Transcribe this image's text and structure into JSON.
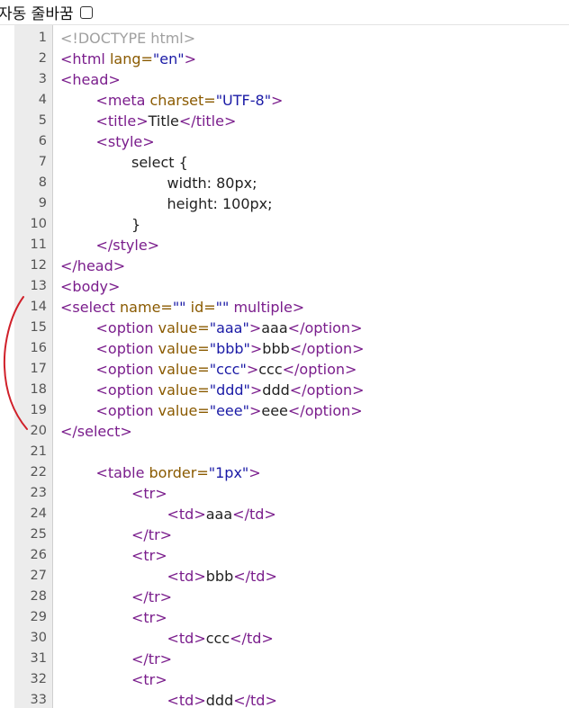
{
  "toolbar": {
    "wrap_label": "자동 줄바꿈",
    "wrap_checked": false
  },
  "lines": [
    {
      "n": "1",
      "indent": 0,
      "tokens": [
        {
          "t": "doc",
          "v": "<!DOCTYPE html>"
        }
      ]
    },
    {
      "n": "2",
      "indent": 0,
      "tokens": [
        {
          "t": "tag",
          "v": "<html "
        },
        {
          "t": "attr",
          "v": "lang="
        },
        {
          "t": "val",
          "v": "\"en\""
        },
        {
          "t": "tag",
          "v": ">"
        }
      ]
    },
    {
      "n": "3",
      "indent": 0,
      "tokens": [
        {
          "t": "tag",
          "v": "<head>"
        }
      ]
    },
    {
      "n": "4",
      "indent": 1,
      "tokens": [
        {
          "t": "tag",
          "v": "<meta "
        },
        {
          "t": "attr",
          "v": "charset="
        },
        {
          "t": "val",
          "v": "\"UTF-8\""
        },
        {
          "t": "tag",
          "v": ">"
        }
      ]
    },
    {
      "n": "5",
      "indent": 1,
      "tokens": [
        {
          "t": "tag",
          "v": "<title>"
        },
        {
          "t": "text",
          "v": "Title"
        },
        {
          "t": "tag",
          "v": "</title>"
        }
      ]
    },
    {
      "n": "6",
      "indent": 1,
      "tokens": [
        {
          "t": "tag",
          "v": "<style>"
        }
      ]
    },
    {
      "n": "7",
      "indent": 2,
      "tokens": [
        {
          "t": "css",
          "v": "select {"
        }
      ]
    },
    {
      "n": "8",
      "indent": 3,
      "tokens": [
        {
          "t": "css",
          "v": "width: 80px;"
        }
      ]
    },
    {
      "n": "9",
      "indent": 3,
      "tokens": [
        {
          "t": "css",
          "v": "height: 100px;"
        }
      ]
    },
    {
      "n": "10",
      "indent": 2,
      "tokens": [
        {
          "t": "css",
          "v": "}"
        }
      ]
    },
    {
      "n": "11",
      "indent": 1,
      "tokens": [
        {
          "t": "tag",
          "v": "</style>"
        }
      ]
    },
    {
      "n": "12",
      "indent": 0,
      "tokens": [
        {
          "t": "tag",
          "v": "</head>"
        }
      ]
    },
    {
      "n": "13",
      "indent": 0,
      "tokens": [
        {
          "t": "tag",
          "v": "<body>"
        }
      ]
    },
    {
      "n": "14",
      "indent": 0,
      "tokens": [
        {
          "t": "tag",
          "v": "<select "
        },
        {
          "t": "attr",
          "v": "name="
        },
        {
          "t": "val",
          "v": "\"\""
        },
        {
          "t": "tag",
          "v": " "
        },
        {
          "t": "attr",
          "v": "id="
        },
        {
          "t": "val",
          "v": "\"\""
        },
        {
          "t": "tag",
          "v": " multiple>"
        }
      ]
    },
    {
      "n": "15",
      "indent": 1,
      "tokens": [
        {
          "t": "tag",
          "v": "<option "
        },
        {
          "t": "attr",
          "v": "value="
        },
        {
          "t": "val",
          "v": "\"aaa\""
        },
        {
          "t": "tag",
          "v": ">"
        },
        {
          "t": "text",
          "v": "aaa"
        },
        {
          "t": "tag",
          "v": "</option>"
        }
      ]
    },
    {
      "n": "16",
      "indent": 1,
      "tokens": [
        {
          "t": "tag",
          "v": "<option "
        },
        {
          "t": "attr",
          "v": "value="
        },
        {
          "t": "val",
          "v": "\"bbb\""
        },
        {
          "t": "tag",
          "v": ">"
        },
        {
          "t": "text",
          "v": "bbb"
        },
        {
          "t": "tag",
          "v": "</option>"
        }
      ]
    },
    {
      "n": "17",
      "indent": 1,
      "tokens": [
        {
          "t": "tag",
          "v": "<option "
        },
        {
          "t": "attr",
          "v": "value="
        },
        {
          "t": "val",
          "v": "\"ccc\""
        },
        {
          "t": "tag",
          "v": ">"
        },
        {
          "t": "text",
          "v": "ccc"
        },
        {
          "t": "tag",
          "v": "</option>"
        }
      ]
    },
    {
      "n": "18",
      "indent": 1,
      "tokens": [
        {
          "t": "tag",
          "v": "<option "
        },
        {
          "t": "attr",
          "v": "value="
        },
        {
          "t": "val",
          "v": "\"ddd\""
        },
        {
          "t": "tag",
          "v": ">"
        },
        {
          "t": "text",
          "v": "ddd"
        },
        {
          "t": "tag",
          "v": "</option>"
        }
      ]
    },
    {
      "n": "19",
      "indent": 1,
      "tokens": [
        {
          "t": "tag",
          "v": "<option "
        },
        {
          "t": "attr",
          "v": "value="
        },
        {
          "t": "val",
          "v": "\"eee\""
        },
        {
          "t": "tag",
          "v": ">"
        },
        {
          "t": "text",
          "v": "eee"
        },
        {
          "t": "tag",
          "v": "</option>"
        }
      ]
    },
    {
      "n": "20",
      "indent": 0,
      "tokens": [
        {
          "t": "tag",
          "v": "</select>"
        }
      ]
    },
    {
      "n": "21",
      "indent": 0,
      "tokens": []
    },
    {
      "n": "22",
      "indent": 1,
      "tokens": [
        {
          "t": "tag",
          "v": "<table "
        },
        {
          "t": "attr",
          "v": "border="
        },
        {
          "t": "val",
          "v": "\"1px\""
        },
        {
          "t": "tag",
          "v": ">"
        }
      ]
    },
    {
      "n": "23",
      "indent": 2,
      "tokens": [
        {
          "t": "tag",
          "v": "<tr>"
        }
      ]
    },
    {
      "n": "24",
      "indent": 3,
      "tokens": [
        {
          "t": "tag",
          "v": "<td>"
        },
        {
          "t": "text",
          "v": "aaa"
        },
        {
          "t": "tag",
          "v": "</td>"
        }
      ]
    },
    {
      "n": "25",
      "indent": 2,
      "tokens": [
        {
          "t": "tag",
          "v": "</tr>"
        }
      ]
    },
    {
      "n": "26",
      "indent": 2,
      "tokens": [
        {
          "t": "tag",
          "v": "<tr>"
        }
      ]
    },
    {
      "n": "27",
      "indent": 3,
      "tokens": [
        {
          "t": "tag",
          "v": "<td>"
        },
        {
          "t": "text",
          "v": "bbb"
        },
        {
          "t": "tag",
          "v": "</td>"
        }
      ]
    },
    {
      "n": "28",
      "indent": 2,
      "tokens": [
        {
          "t": "tag",
          "v": "</tr>"
        }
      ]
    },
    {
      "n": "29",
      "indent": 2,
      "tokens": [
        {
          "t": "tag",
          "v": "<tr>"
        }
      ]
    },
    {
      "n": "30",
      "indent": 3,
      "tokens": [
        {
          "t": "tag",
          "v": "<td>"
        },
        {
          "t": "text",
          "v": "ccc"
        },
        {
          "t": "tag",
          "v": "</td>"
        }
      ]
    },
    {
      "n": "31",
      "indent": 2,
      "tokens": [
        {
          "t": "tag",
          "v": "</tr>"
        }
      ]
    },
    {
      "n": "32",
      "indent": 2,
      "tokens": [
        {
          "t": "tag",
          "v": "<tr>"
        }
      ]
    },
    {
      "n": "33",
      "indent": 3,
      "tokens": [
        {
          "t": "tag",
          "v": "<td>"
        },
        {
          "t": "text",
          "v": "ddd"
        },
        {
          "t": "tag",
          "v": "</td>"
        }
      ]
    }
  ],
  "colors": {
    "tag": "#7a1d8c",
    "attr": "#8a5a00",
    "val": "#1a1aa6",
    "doctype": "#a0a0a0",
    "annotation": "#d0202a"
  }
}
